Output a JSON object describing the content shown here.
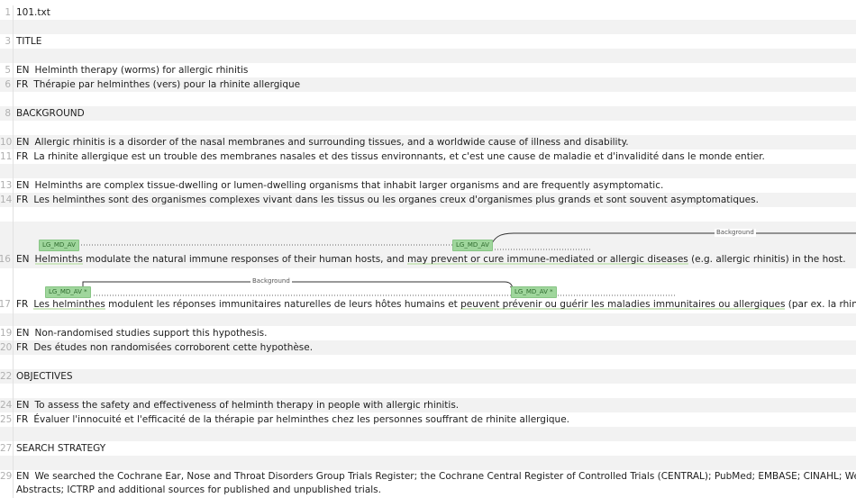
{
  "lines": [
    {
      "num": "1",
      "lang": "",
      "text": "101.txt"
    },
    {
      "num": "3",
      "lang": "",
      "text": "TITLE"
    },
    {
      "num": "5",
      "lang": "EN",
      "text": "Helminth therapy (worms) for allergic rhinitis"
    },
    {
      "num": "6",
      "lang": "FR",
      "text": "Thérapie par helminthes (vers) pour la rhinite allergique"
    },
    {
      "num": "8",
      "lang": "",
      "text": "BACKGROUND"
    },
    {
      "num": "10",
      "lang": "EN",
      "text": "Allergic rhinitis is a disorder of the nasal membranes and surrounding tissues, and a worldwide cause of illness and disability."
    },
    {
      "num": "11",
      "lang": "FR",
      "text": "La rhinite allergique est un trouble des membranes nasales et des tissus environnants, et c'est une cause de maladie et d'invalidité dans le monde entier."
    },
    {
      "num": "13",
      "lang": "EN",
      "text": "Helminths are complex tissue-dwelling or lumen-dwelling organisms that inhabit larger organisms and are frequently asymptomatic."
    },
    {
      "num": "14",
      "lang": "FR",
      "text": "Les helminthes sont des organismes complexes vivant dans les tissus ou les organes creux d'organismes plus grands et sont souvent asymptomatiques."
    },
    {
      "num": "16",
      "lang": "EN",
      "parts": [
        "Helminths",
        " modulate the natural immune responses of their human hosts, and ",
        "may prevent or cure immune-mediated or allergic diseases",
        " (e.g. allergic rhinitis) in the host."
      ]
    },
    {
      "num": "17",
      "lang": "FR",
      "parts": [
        "Les helminthes",
        " modulent les réponses immunitaires naturelles de leurs hôtes humains et ",
        "peuvent prévenir ou guérir les maladies immunitaires ou allergiques",
        " (par ex. la rhinite allergique) chez l'hôte."
      ]
    },
    {
      "num": "19",
      "lang": "EN",
      "text": "Non-randomised studies support this hypothesis."
    },
    {
      "num": "20",
      "lang": "FR",
      "text": "Des études non randomisées corroborent cette hypothèse."
    },
    {
      "num": "22",
      "lang": "",
      "text": "OBJECTIVES"
    },
    {
      "num": "24",
      "lang": "EN",
      "text": "To assess the safety and effectiveness of helminth therapy in people with allergic rhinitis."
    },
    {
      "num": "25",
      "lang": "FR",
      "text": "Évaluer l'innocuité et l'efficacité de la thérapie par helminthes chez les personnes souffrant de rhinite allergique."
    },
    {
      "num": "27",
      "lang": "",
      "text": "SEARCH STRATEGY"
    },
    {
      "num": "29",
      "lang": "EN",
      "text": "We searched the Cochrane Ear, Nose and Throat Disorders Group Trials Register; the Cochrane Central Register of Controlled Trials (CENTRAL); PubMed; EMBASE; CINAHL; Web of Science; BIOSIS Previ",
      "text2": "Abstracts; ICTRP and additional sources for published and unpublished trials."
    }
  ],
  "annotations": {
    "tag_en_1": "LG_MD_AV",
    "tag_en_2": "LG_MD_AV",
    "tag_fr_1": "LG_MD_AV *",
    "tag_fr_2": "LG_MD_AV *",
    "arc_en_label": "Background",
    "arc_fr_label": "Background"
  },
  "colors": {
    "tag_bg": "#9fd69c",
    "highlight": "#cfe7c2",
    "stripe": "#f2f2f2"
  }
}
